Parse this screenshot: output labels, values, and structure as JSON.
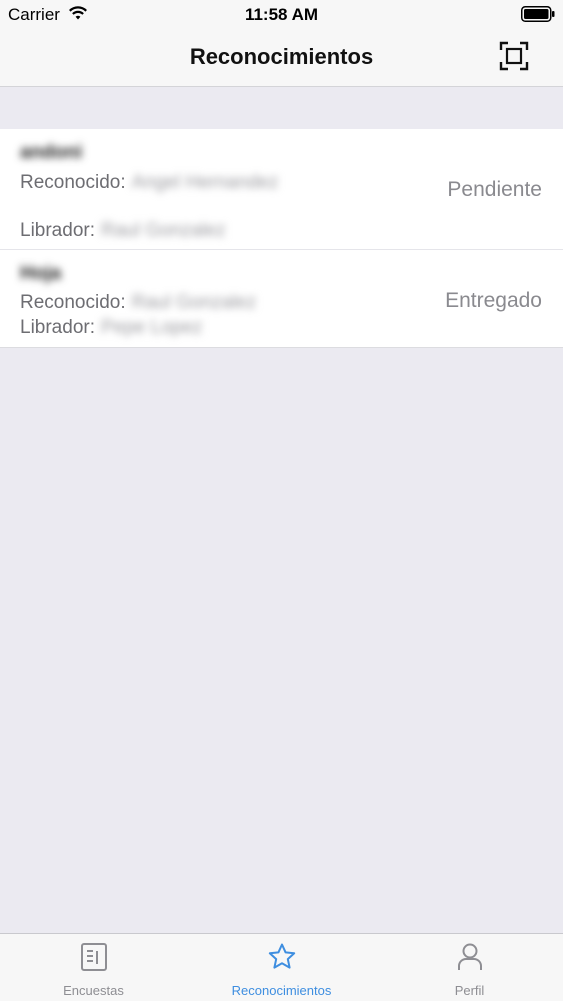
{
  "status_bar": {
    "carrier": "Carrier",
    "time": "11:58 AM",
    "wifi_icon": "wifi-icon",
    "battery_icon": "battery-icon"
  },
  "nav": {
    "title": "Reconocimientos",
    "scan_icon": "scan-icon"
  },
  "items": [
    {
      "name": "andoni",
      "reconocido_label": "Reconocido:",
      "reconocido_value": "Angel Hernandez",
      "librador_label": "Librador:",
      "librador_value": "Raul Gonzalez",
      "status": "Pendiente"
    },
    {
      "name": "Hoja",
      "reconocido_label": "Reconocido:",
      "reconocido_value": "Raul Gonzalez",
      "librador_label": "Librador:",
      "librador_value": "Pepe Lopez",
      "status": "Entregado"
    }
  ],
  "tabbar": {
    "tabs": [
      {
        "label": "Encuestas",
        "icon": "survey-icon",
        "active": false
      },
      {
        "label": "Reconocimientos",
        "icon": "star-icon",
        "active": true
      },
      {
        "label": "Perfil",
        "icon": "person-icon",
        "active": false
      }
    ],
    "active_color": "#3e8ee0",
    "inactive_color": "#8e8e93"
  }
}
